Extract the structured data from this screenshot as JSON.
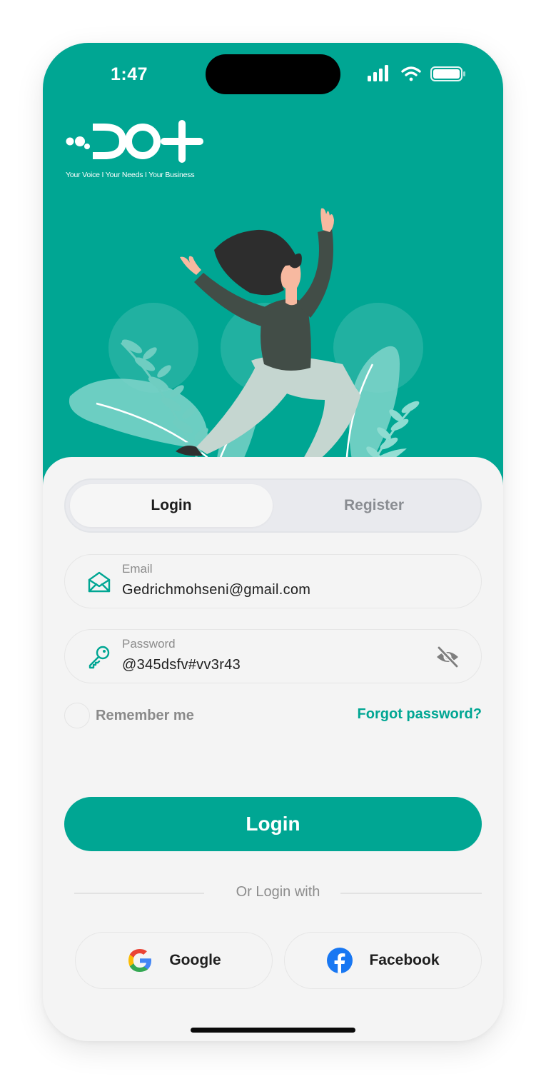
{
  "status_bar": {
    "time": "1:47",
    "icons": [
      "signal-icon",
      "wifi-icon",
      "battery-icon"
    ]
  },
  "brand": {
    "logo_text": "DO+",
    "tagline": "Your Voice I Your Needs I Your Business"
  },
  "tabs": {
    "login_label": "Login",
    "register_label": "Register",
    "active": "Login"
  },
  "email": {
    "label": "Email",
    "value": "Gedrichmohseni@gmail.com",
    "icon": "envelope-open-icon"
  },
  "password": {
    "label": "Password",
    "value": "@345dsfv#vv3r43",
    "icon": "key-icon",
    "toggle_icon": "eye-off-icon"
  },
  "remember": {
    "label": "Remember me",
    "checked": false
  },
  "forgot_label": "Forgot password?",
  "login_button_label": "Login",
  "divider_text": "Or Login with",
  "social": {
    "google_label": "Google",
    "facebook_label": "Facebook"
  },
  "colors": {
    "primary": "#00a693",
    "background": "#f4f4f4",
    "segment_bg": "#e9eaee",
    "text_dark": "#1e1e1e",
    "text_muted": "#8a8a8a"
  }
}
